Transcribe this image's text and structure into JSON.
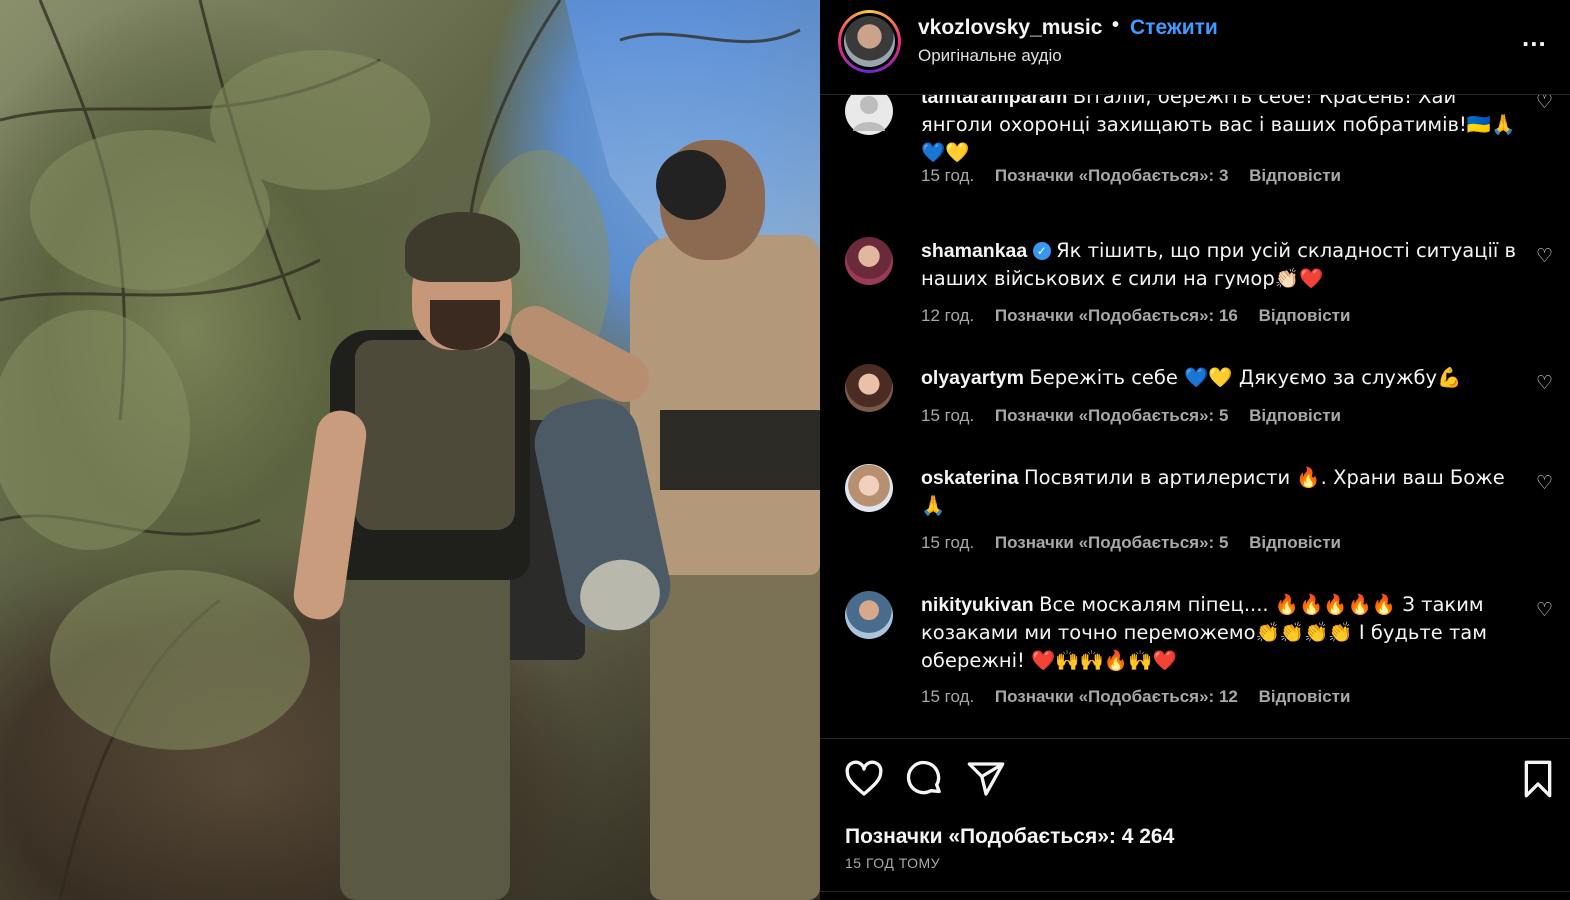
{
  "post": {
    "username": "vkozlovsky_music",
    "separator": "•",
    "follow_label": "Стежити",
    "audio_label": "Оригінальне аудіо",
    "more_label": "..."
  },
  "comments": [
    {
      "user": "tamtaramparam",
      "text": "Віталій, бережіть себе! Красень! Хай янголи охоронці захищають вас і ваших побратимів!🇺🇦🙏💙💛",
      "time": "15 год.",
      "likes": "Позначки «Подобається»: 3",
      "reply": "Відповісти",
      "verified": false
    },
    {
      "user": "shamankaa",
      "text": "Як тішить, що при усій складності ситуації в наших військових є сили на гумор👏🏻❤️",
      "time": "12 год.",
      "likes": "Позначки «Подобається»: 16",
      "reply": "Відповісти",
      "verified": true
    },
    {
      "user": "olyayartym",
      "text": "Бережіть себе 💙💛 Дякуємо за службу💪",
      "time": "15 год.",
      "likes": "Позначки «Подобається»: 5",
      "reply": "Відповісти",
      "verified": false
    },
    {
      "user": "oskaterina",
      "text": "Посвятили в артилеристи 🔥. Храни ваш Боже 🙏",
      "time": "15 год.",
      "likes": "Позначки «Подобається»: 5",
      "reply": "Відповісти",
      "verified": false
    },
    {
      "user": "nikityukivan",
      "text": "Все москалям піпец.... 🔥🔥🔥🔥🔥 З таким козаками ми точно переможемо👏👏👏👏 І будьте там обережні! ❤️🙌🙌🔥🙌❤️",
      "time": "15 год.",
      "likes": "Позначки «Подобається»: 12",
      "reply": "Відповісти",
      "verified": false
    }
  ],
  "footer": {
    "likes_total": "Позначки «Подобається»: 4 264",
    "time_ago": "15 ГОД ТОМУ"
  },
  "icons": {
    "like": "heart-icon",
    "comment": "comment-bubble-icon",
    "share": "paper-plane-icon",
    "save": "bookmark-icon"
  },
  "colors": {
    "background": "#000000",
    "text": "#f5f5f5",
    "muted": "#a8a8a8",
    "link": "#3e9bff",
    "verified": "#3897f0"
  }
}
